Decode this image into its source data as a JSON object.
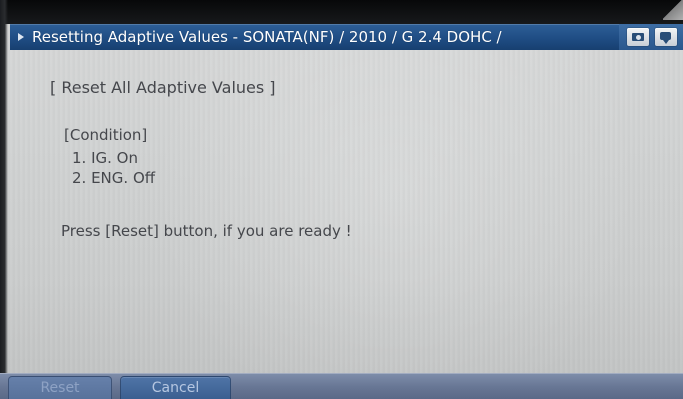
{
  "window": {
    "title": "Resetting Adaptive Values - SONATA(NF) / 2010 / G 2.4 DOHC /"
  },
  "toolbar": {
    "icons": [
      {
        "name": "camera-icon"
      },
      {
        "name": "chat-icon"
      }
    ]
  },
  "content": {
    "heading": "[ Reset All Adaptive Values ]",
    "condition_title": "[Condition]",
    "conditions": [
      "1. IG. On",
      "2. ENG. Off"
    ],
    "message": "Press [Reset] button, if you are ready !"
  },
  "buttons": {
    "reset": "Reset",
    "cancel": "Cancel"
  },
  "colors": {
    "title_bar": "#1f4d84",
    "content_background": "#d1d3d3",
    "text": "#45474c",
    "bottom_bar": "#677694"
  }
}
